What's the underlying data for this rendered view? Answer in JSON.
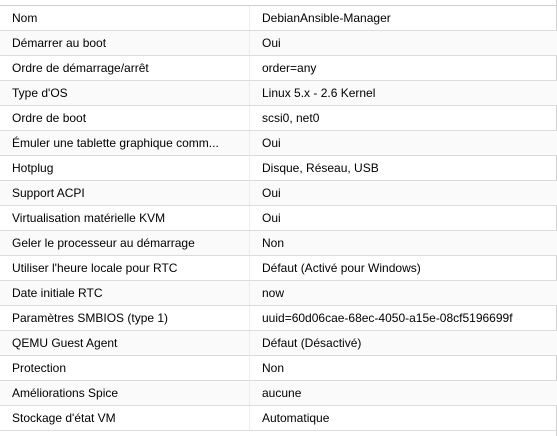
{
  "options": {
    "rows": [
      {
        "key": "Nom",
        "value": "DebianAnsible-Manager"
      },
      {
        "key": "Démarrer au boot",
        "value": "Oui"
      },
      {
        "key": "Ordre de démarrage/arrêt",
        "value": "order=any"
      },
      {
        "key": "Type d'OS",
        "value": "Linux 5.x - 2.6 Kernel"
      },
      {
        "key": "Ordre de boot",
        "value": "scsi0, net0"
      },
      {
        "key": "Émuler une tablette graphique comm...",
        "value": "Oui"
      },
      {
        "key": "Hotplug",
        "value": "Disque, Réseau, USB"
      },
      {
        "key": "Support ACPI",
        "value": "Oui"
      },
      {
        "key": "Virtualisation matérielle KVM",
        "value": "Oui"
      },
      {
        "key": "Geler le processeur au démarrage",
        "value": "Non"
      },
      {
        "key": "Utiliser l'heure locale pour RTC",
        "value": "Défaut (Activé pour Windows)"
      },
      {
        "key": "Date initiale RTC",
        "value": "now"
      },
      {
        "key": "Paramètres SMBIOS (type 1)",
        "value": "uuid=60d06cae-68ec-4050-a15e-08cf5196699f"
      },
      {
        "key": "QEMU Guest Agent",
        "value": "Défaut (Désactivé)"
      },
      {
        "key": "Protection",
        "value": "Non"
      },
      {
        "key": "Améliorations Spice",
        "value": "aucune"
      },
      {
        "key": "Stockage d'état VM",
        "value": "Automatique"
      }
    ]
  }
}
